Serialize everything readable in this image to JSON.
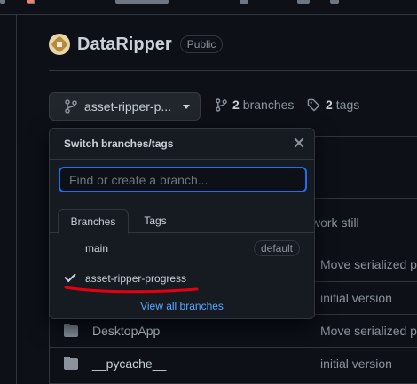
{
  "repo": {
    "name": "DataRipper",
    "visibility": "Public"
  },
  "toolbar": {
    "branch_label": "asset-ripper-p...",
    "branches_count": "2",
    "branches_label": "branches",
    "tags_count": "2",
    "tags_label": "tags"
  },
  "dropdown": {
    "title": "Switch branches/tags",
    "search_placeholder": "Find or create a branch...",
    "tabs": [
      {
        "label": "Branches",
        "active": true
      },
      {
        "label": "Tags",
        "active": false
      }
    ],
    "items": [
      {
        "name": "main",
        "badge": "default",
        "selected": false
      },
      {
        "name": "asset-ripper-progress",
        "badge": "",
        "selected": true
      }
    ],
    "view_all": "View all branches"
  },
  "files": {
    "messages_right": [
      "work still",
      "Move serialized pa",
      "initial version"
    ],
    "rows": [
      {
        "name": "DesktopApp",
        "message": "Move serialized pa"
      },
      {
        "name": "__pycache__",
        "message": "initial version"
      }
    ]
  },
  "colors": {
    "background": "#0d1117",
    "accent_blue": "#58a6ff",
    "focus_blue": "#1f6feb",
    "annotation_red": "#e6000f"
  }
}
